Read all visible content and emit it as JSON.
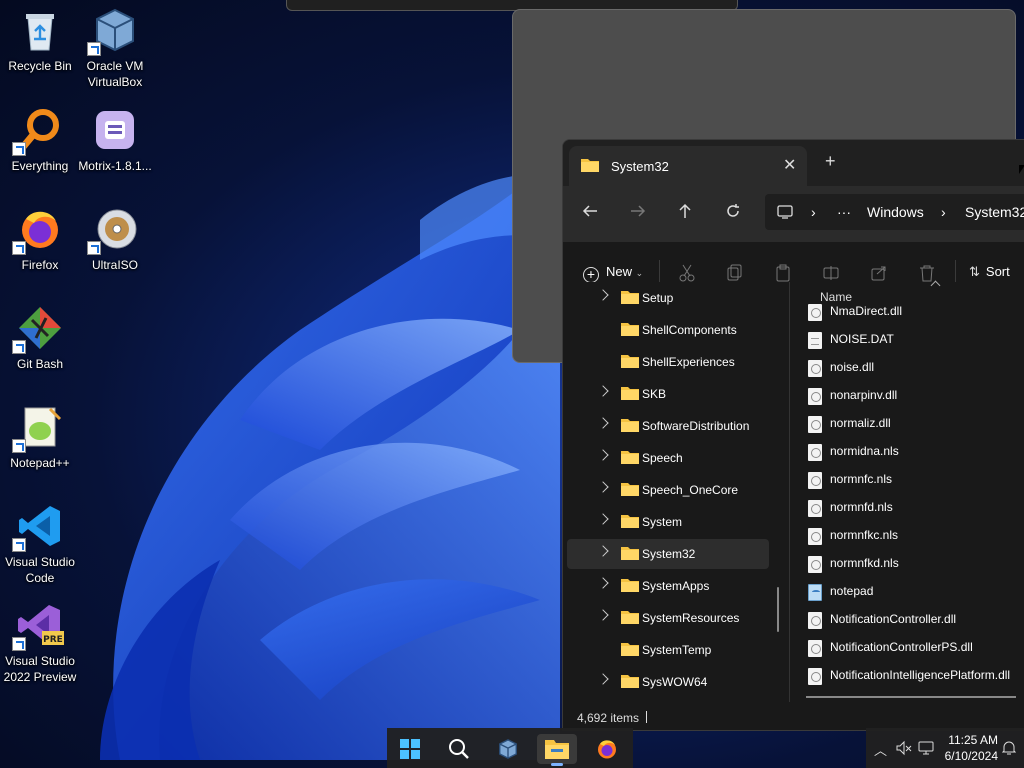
{
  "desktop": {
    "icons": [
      {
        "label": "Recycle Bin",
        "icon": "recycle-bin-icon"
      },
      {
        "label": "Oracle VM VirtualBox",
        "icon": "virtualbox-icon"
      },
      {
        "label": "Everything",
        "icon": "everything-search-icon"
      },
      {
        "label": "Motrix-1.8.1...",
        "icon": "motrix-icon"
      },
      {
        "label": "Firefox",
        "icon": "firefox-icon"
      },
      {
        "label": "UltraISO",
        "icon": "ultraiso-disc-icon"
      },
      {
        "label": "Git Bash",
        "icon": "git-bash-icon"
      },
      {
        "label": "Notepad++",
        "icon": "notepad-plus-plus-icon"
      },
      {
        "label": "Visual Studio Code",
        "icon": "vscode-icon"
      },
      {
        "label": "Visual Studio 2022 Preview",
        "icon": "visual-studio-preview-icon"
      }
    ],
    "vs_badge": "PRE"
  },
  "explorer": {
    "tab_title": "System32",
    "new_tab": "+",
    "close": "✕",
    "breadcrumb": [
      "Windows",
      "System32"
    ],
    "overflow": "···",
    "commands": {
      "new": "New",
      "sort": "Sort"
    },
    "column_name": "Name",
    "tree": [
      {
        "label": "Setup",
        "expandable": true,
        "selected": false
      },
      {
        "label": "ShellComponents",
        "expandable": false,
        "selected": false
      },
      {
        "label": "ShellExperiences",
        "expandable": false,
        "selected": false
      },
      {
        "label": "SKB",
        "expandable": true,
        "selected": false
      },
      {
        "label": "SoftwareDistribution",
        "expandable": true,
        "selected": false
      },
      {
        "label": "Speech",
        "expandable": true,
        "selected": false
      },
      {
        "label": "Speech_OneCore",
        "expandable": true,
        "selected": false
      },
      {
        "label": "System",
        "expandable": true,
        "selected": false
      },
      {
        "label": "System32",
        "expandable": true,
        "selected": true
      },
      {
        "label": "SystemApps",
        "expandable": true,
        "selected": false
      },
      {
        "label": "SystemResources",
        "expandable": true,
        "selected": false
      },
      {
        "label": "SystemTemp",
        "expandable": false,
        "selected": false
      },
      {
        "label": "SysWOW64",
        "expandable": true,
        "selected": false
      }
    ],
    "files": [
      {
        "name": "NmaDirect.dll",
        "kind": "dll"
      },
      {
        "name": "NOISE.DAT",
        "kind": "txt"
      },
      {
        "name": "noise.dll",
        "kind": "dll"
      },
      {
        "name": "nonarpinv.dll",
        "kind": "dll"
      },
      {
        "name": "normaliz.dll",
        "kind": "dll"
      },
      {
        "name": "normidna.nls",
        "kind": "dll"
      },
      {
        "name": "normnfc.nls",
        "kind": "dll"
      },
      {
        "name": "normnfd.nls",
        "kind": "dll"
      },
      {
        "name": "normnfkc.nls",
        "kind": "dll"
      },
      {
        "name": "normnfkd.nls",
        "kind": "dll"
      },
      {
        "name": "notepad",
        "kind": "app"
      },
      {
        "name": "NotificationController.dll",
        "kind": "dll"
      },
      {
        "name": "NotificationControllerPS.dll",
        "kind": "dll"
      },
      {
        "name": "NotificationIntelligencePlatform.dll",
        "kind": "dll"
      }
    ],
    "status": "4,692 items"
  },
  "taskbar": {
    "apps": [
      "start-icon",
      "search-icon",
      "virtualbox-icon",
      "file-explorer-icon",
      "firefox-icon"
    ],
    "active_app": "file-explorer-icon",
    "clock_time": "11:25 AM",
    "clock_date": "6/10/2024"
  },
  "colors": {
    "accent": "#7cb3ff",
    "folder": "#f5c342",
    "window_bg": "#191919"
  }
}
